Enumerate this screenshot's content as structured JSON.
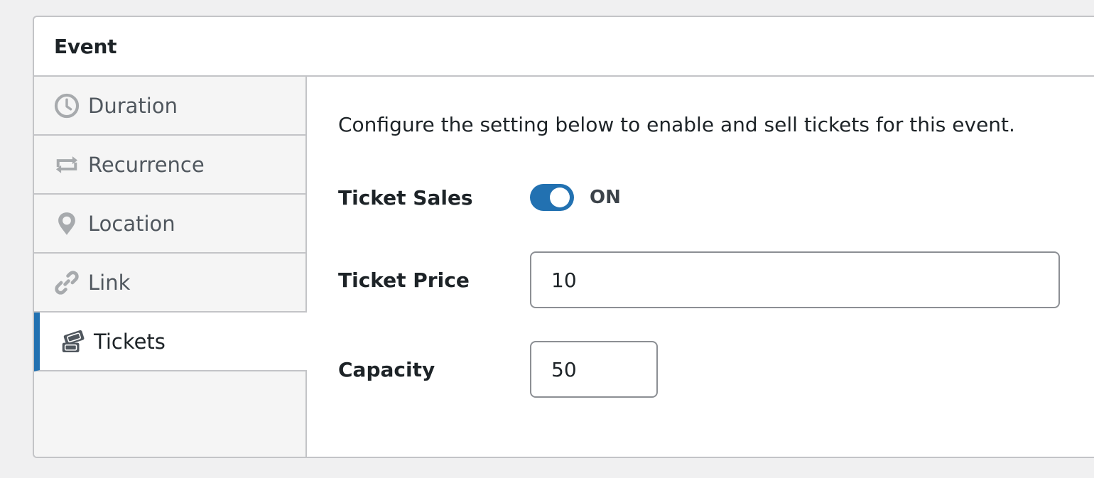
{
  "panel": {
    "title": "Event"
  },
  "tabs": [
    {
      "id": "duration",
      "label": "Duration",
      "icon": "clock-icon",
      "active": false
    },
    {
      "id": "recurrence",
      "label": "Recurrence",
      "icon": "repeat-icon",
      "active": false
    },
    {
      "id": "location",
      "label": "Location",
      "icon": "location-pin-icon",
      "active": false
    },
    {
      "id": "link",
      "label": "Link",
      "icon": "link-icon",
      "active": false
    },
    {
      "id": "tickets",
      "label": "Tickets",
      "icon": "tickets-icon",
      "active": true
    }
  ],
  "content": {
    "intro": "Configure the setting below to enable and sell tickets for this event.",
    "ticket_sales": {
      "label": "Ticket Sales",
      "state": "ON",
      "enabled": true
    },
    "ticket_price": {
      "label": "Ticket Price",
      "value": "10"
    },
    "capacity": {
      "label": "Capacity",
      "value": "50"
    }
  },
  "colors": {
    "accent": "#2271b1",
    "border": "#c3c4c7",
    "tab_bg": "#f5f5f5",
    "page_bg": "#f0f0f1"
  }
}
